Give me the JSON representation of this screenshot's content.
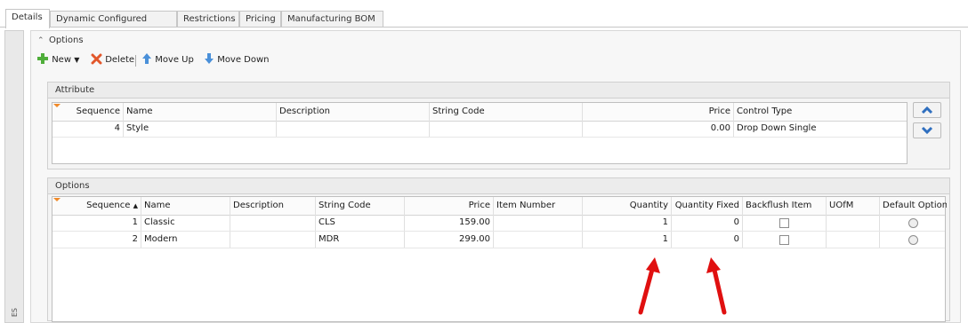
{
  "tabs": [
    "Details",
    "Dynamic Configured Items",
    "Restrictions",
    "Pricing",
    "Manufacturing BOM"
  ],
  "left_strip_label": "ES",
  "options_section": {
    "title": "Options"
  },
  "toolbar": {
    "new_label": "New",
    "delete_label": "Delete",
    "move_up_label": "Move Up",
    "move_down_label": "Move Down"
  },
  "attribute_group": {
    "title": "Attribute",
    "columns": [
      "Sequence",
      "Name",
      "Description",
      "String Code",
      "Price",
      "Control Type"
    ],
    "rows": [
      {
        "sequence": "4",
        "name": "Style",
        "description": "",
        "string_code": "",
        "price": "0.00",
        "control_type": "Drop Down Single"
      }
    ]
  },
  "options_group": {
    "title": "Options",
    "columns": [
      "Sequence",
      "Name",
      "Description",
      "String Code",
      "Price",
      "Item Number",
      "Quantity",
      "Quantity Fixed",
      "Backflush Item",
      "UOfM",
      "Default Option"
    ],
    "sort_indicator": "▲",
    "rows": [
      {
        "sequence": "1",
        "name": "Classic",
        "description": "",
        "string_code": "CLS",
        "price": "159.00",
        "item_number": "",
        "quantity": "1",
        "quantity_fixed": "0",
        "backflush": false,
        "uofm": "",
        "default": false
      },
      {
        "sequence": "2",
        "name": "Modern",
        "description": "",
        "string_code": "MDR",
        "price": "299.00",
        "item_number": "",
        "quantity": "1",
        "quantity_fixed": "0",
        "backflush": false,
        "uofm": "",
        "default": false
      }
    ]
  },
  "colors": {
    "annotation_arrow": "#e01010",
    "filter_corner": "#f08a2a",
    "nav_arrow": "#2f6fbf"
  },
  "icons": {
    "new": "plus-icon",
    "delete": "delete-x-icon",
    "move_up": "arrow-up-icon",
    "move_down": "arrow-down-icon"
  }
}
